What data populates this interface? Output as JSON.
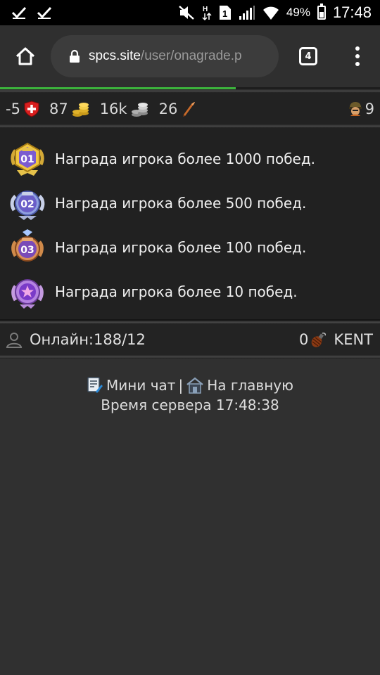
{
  "status_bar": {
    "battery_percent": "49%",
    "time": "17:48",
    "battery_level": 0.49,
    "icons": [
      "check-icon",
      "check-icon",
      "mute-icon",
      "hplus-icon",
      "sim-icon",
      "signal-icon",
      "wifi-icon",
      "battery-icon"
    ]
  },
  "browser": {
    "url_host": "spcs.site",
    "url_path": "/user/onagrade.p",
    "tab_count": "4"
  },
  "progress": {
    "fraction": 0.62,
    "color": "#3cb43c"
  },
  "stats": {
    "health": "-5",
    "gold": "87",
    "silver": "16k",
    "ammo": "26",
    "rank": "9"
  },
  "awards": [
    {
      "text": "Награда игрока более 1000 побед.",
      "badge": "01",
      "icon": "gold-medal-icon"
    },
    {
      "text": "Награда игрока более 500 побед.",
      "badge": "02",
      "icon": "silver-medal-icon"
    },
    {
      "text": "Награда игрока более 100 побед.",
      "badge": "03",
      "icon": "bronze-medal-icon"
    },
    {
      "text": "Награда игрока более 10 побед.",
      "badge": "",
      "icon": "star-medal-icon"
    }
  ],
  "online": {
    "label": "Онлайн:188/12",
    "grenades": "0",
    "username": "KENT"
  },
  "footer": {
    "mini_chat": "Мини чат",
    "divider": "|",
    "home": "На главную",
    "server_time": "Время сервера 17:48:38"
  }
}
